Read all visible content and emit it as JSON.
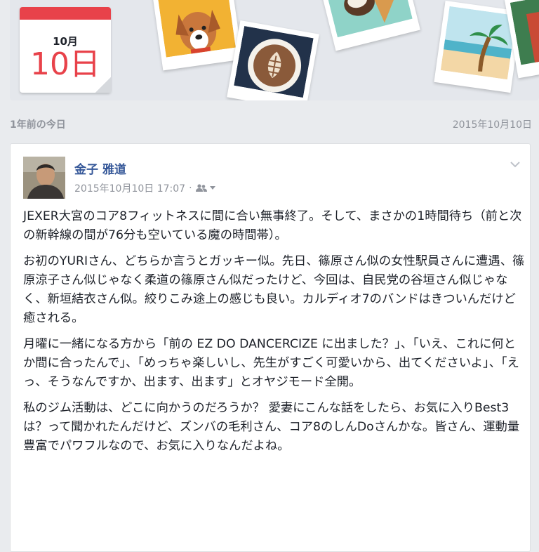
{
  "banner": {
    "calendar_month": "10月",
    "calendar_day": "10日"
  },
  "section": {
    "label": "1年前の今日",
    "date": "2015年10月10日"
  },
  "post": {
    "author": "金子 雅道",
    "timestamp": "2015年10月10日 17:07",
    "separator": "·",
    "privacy_icon": "friends-icon",
    "paragraphs": [
      "JEXER大宮のコア8フィットネスに間に合い無事終了。そして、まさかの1時間待ち（前と次の新幹線の間が76分も空いている魔の時間帯）。",
      "お初のYURIさん、どちらか言うとガッキー似。先日、篠原さん似の女性駅員さんに遭遇、篠原涼子さん似じゃなく柔道の篠原さん似だったけど、今回は、自民党の谷垣さん似じゃなく、新垣結衣さん似。絞りこみ途上の感じも良い。カルディオ7のバンドはきついんだけど癒される。",
      "月曜に一緒になる方から「前の EZ DO DANCERCIZE に出ました？」、「いえ、これに何とか間に合ったんで」、「めっちゃ楽しいし、先生がすごく可愛いから、出てくださいよ」、「えっ、そうなんですか、出ます、出ます」とオヤジモード全開。",
      "私のジム活動は、どこに向かうのだろうか？ 愛妻にこんな話をしたら、お気に入りBest3は？って聞かれたんだけど、ズンバの毛利さん、コア8のしんDoさんかな。皆さん、運動量豊富でパワフルなので、お気に入りなんだよね。"
    ]
  },
  "colors": {
    "accent_red": "#e8424a",
    "link_blue": "#365899",
    "muted_gray": "#90949c"
  }
}
